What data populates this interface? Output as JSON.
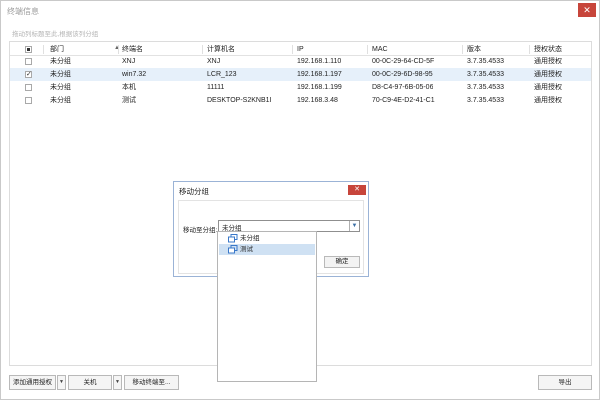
{
  "window": {
    "title": "终端信息",
    "close_glyph": "✕"
  },
  "group_hint": "拖动列标题至此,根据该列分组",
  "table": {
    "headers": {
      "dept": "部门",
      "terminal": "终端名",
      "computer": "计算机名",
      "ip": "IP",
      "mac": "MAC",
      "version": "版本",
      "license": "授权状态"
    },
    "rows": [
      {
        "checked": "",
        "dept": "未分组",
        "terminal": "XNJ",
        "computer": "XNJ",
        "ip": "192.168.1.110",
        "mac": "00-0C-29-64-CD-5F",
        "version": "3.7.35.4533",
        "license": "通用授权"
      },
      {
        "checked": "✓",
        "dept": "未分组",
        "terminal": "win7.32",
        "computer": "LCR_123",
        "ip": "192.168.1.197",
        "mac": "00-0C-29-6D-98-95",
        "version": "3.7.35.4533",
        "license": "通用授权"
      },
      {
        "checked": "",
        "dept": "未分组",
        "terminal": "本机",
        "computer": "11111",
        "ip": "192.168.1.199",
        "mac": "D8-C4-97-6B-05-06",
        "version": "3.7.35.4533",
        "license": "通用授权"
      },
      {
        "checked": "",
        "dept": "未分组",
        "terminal": "测试",
        "computer": "DESKTOP-S2KNB1I",
        "ip": "192.168.3.48",
        "mac": "70-C9-4E-D2-41-C1",
        "version": "3.7.35.4533",
        "license": "通用授权"
      }
    ]
  },
  "dialog": {
    "title": "移动分组",
    "close_glyph": "✕",
    "label": "移动至分组:",
    "selected": "未分组",
    "ok": "确定",
    "options": [
      "未分组",
      "测试"
    ]
  },
  "bottom": {
    "add_license": "添加通用授权",
    "shutdown": "关机",
    "move_terminal": "移动终端至...",
    "export": "导出",
    "dropdown_glyph": "▼"
  },
  "colors": {
    "selected_row": "#e6f0fa",
    "close_red": "#c7453b",
    "option_highlight": "#cfe1f3",
    "group_icon": "#3a78c9"
  }
}
